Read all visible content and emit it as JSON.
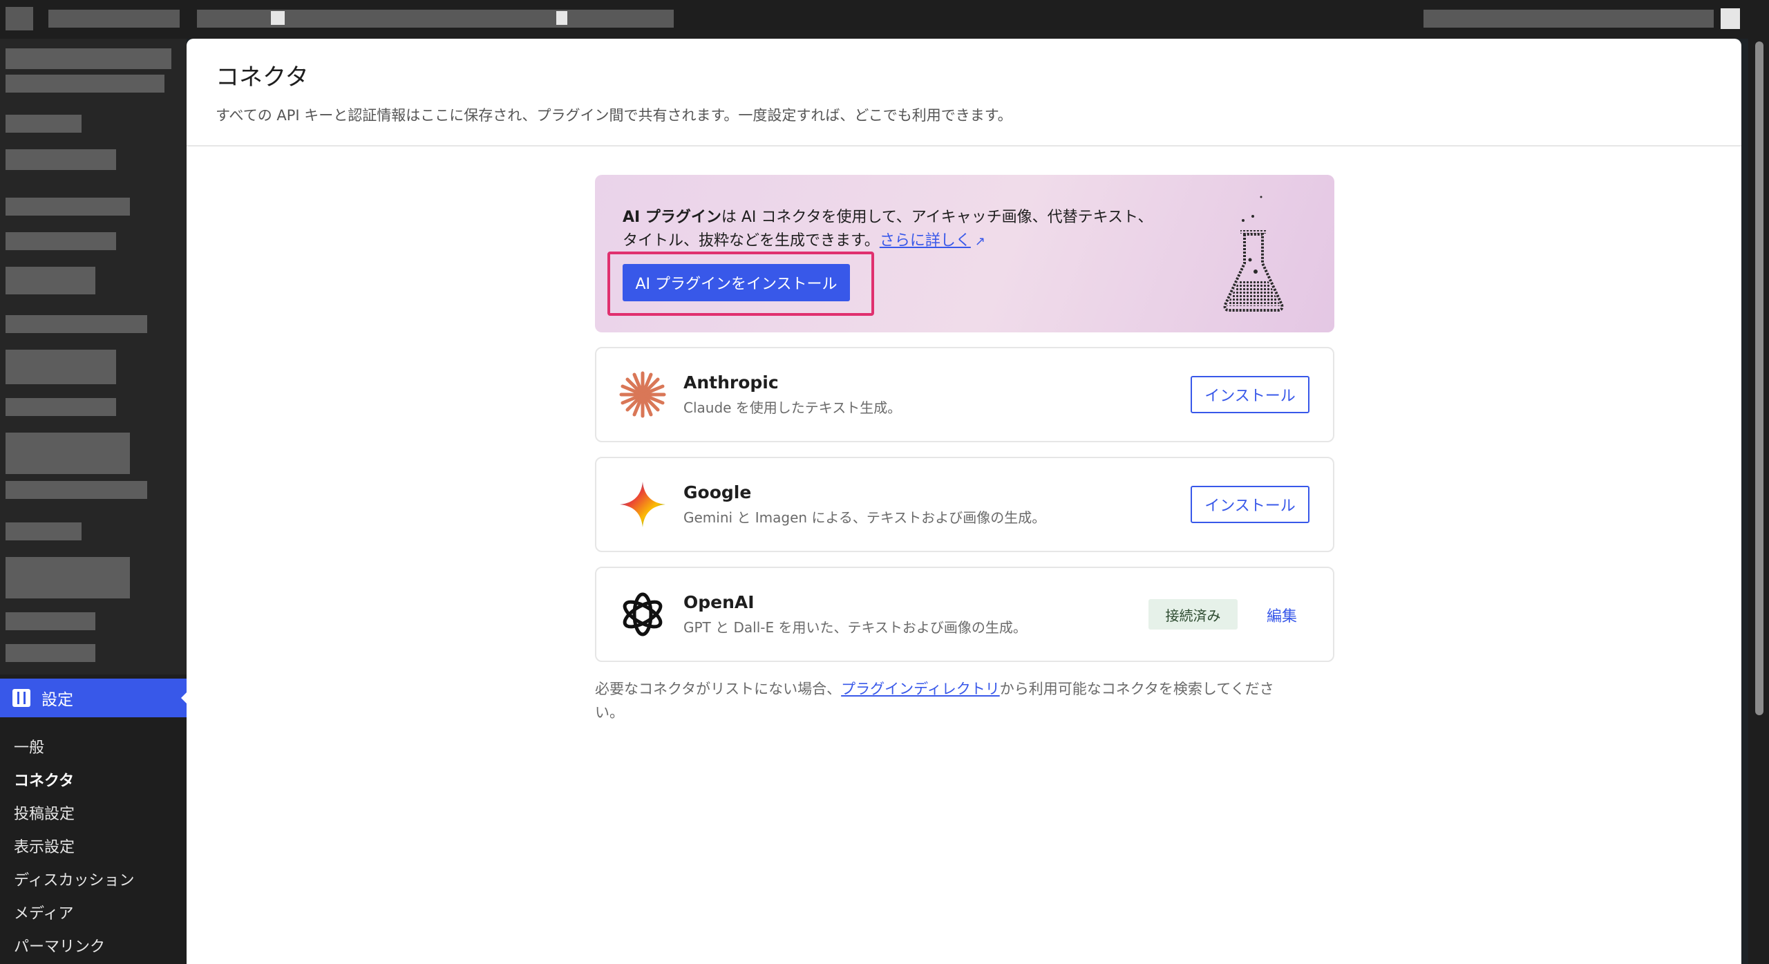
{
  "sidebar": {
    "current_section": "設定",
    "submenu": [
      {
        "label": "一般",
        "active": false
      },
      {
        "label": "コネクタ",
        "active": true
      },
      {
        "label": "投稿設定",
        "active": false
      },
      {
        "label": "表示設定",
        "active": false
      },
      {
        "label": "ディスカッション",
        "active": false
      },
      {
        "label": "メディア",
        "active": false
      },
      {
        "label": "パーマリンク",
        "active": false
      }
    ]
  },
  "header": {
    "title": "コネクタ",
    "subtitle": "すべての API キーと認証情報はここに保存され、プラグイン間で共有されます。一度設定すれば、どこでも利用できます。"
  },
  "promo": {
    "bold": "AI プラグイン",
    "text_line1": "は AI コネクタを使用して、アイキャッチ画像、代替テキスト、",
    "text_line2": "タイトル、抜粋などを生成できます。",
    "link": "さらに詳しく",
    "link_arrow": "↗",
    "button": "AI プラグインをインストール"
  },
  "connectors": [
    {
      "name": "Anthropic",
      "description": "Claude を使用したテキスト生成。",
      "action": "インストール",
      "icon": "anthropic-icon"
    },
    {
      "name": "Google",
      "description": "Gemini と Imagen による、テキストおよび画像の生成。",
      "action": "インストール",
      "icon": "google-gemini-icon"
    },
    {
      "name": "OpenAI",
      "description": "GPT と Dall-E を用いた、テキストおよび画像の生成。",
      "status": "接続済み",
      "action": "編集",
      "icon": "openai-icon"
    }
  ],
  "footer": {
    "before": "必要なコネクタがリストにない場合、",
    "link": "プラグインディレクトリ",
    "after": "から利用可能なコネクタを検索してください。"
  },
  "colors": {
    "accent": "#3858e9",
    "highlight": "#e0306f",
    "anthropic": "#d97757"
  }
}
